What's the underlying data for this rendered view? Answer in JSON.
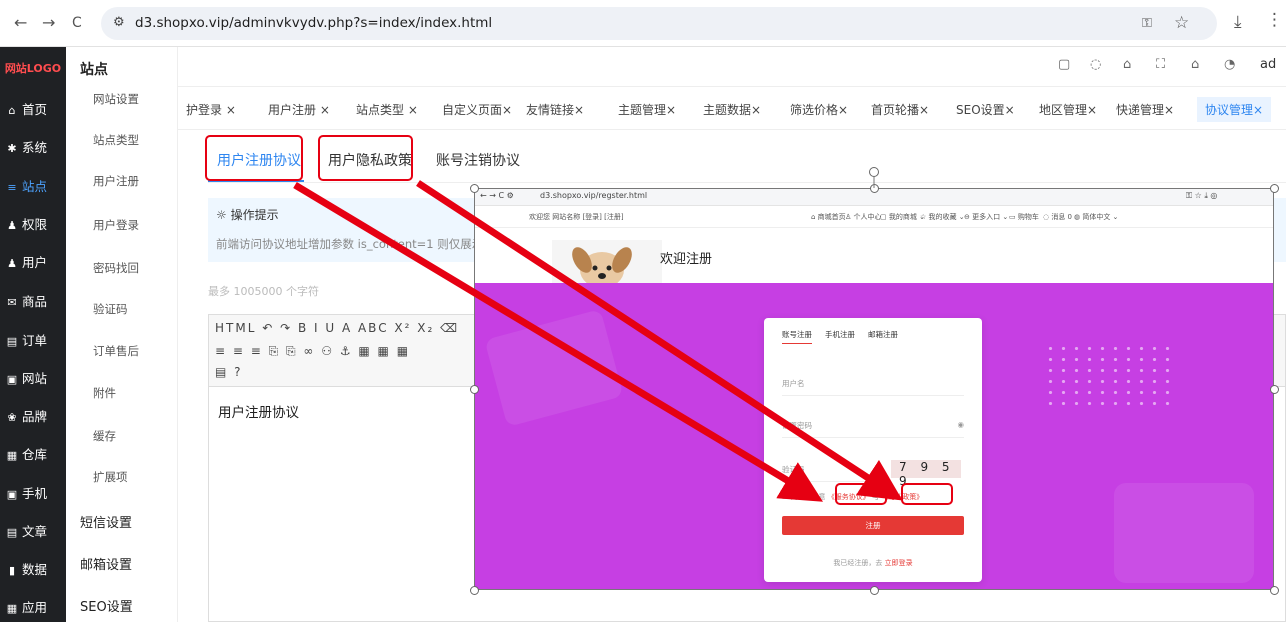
{
  "browser": {
    "url": "d3.shopxo.vip/adminvkvydv.php?s=index/index.html",
    "back_icon": "←",
    "forward_icon": "→",
    "reload_icon": "C",
    "tune_icon": "⚙",
    "password_icon": "⚿",
    "star_icon": "☆",
    "download_icon": "⤓",
    "more_icon": "⋮"
  },
  "logo": "网站LOGO",
  "main_nav": [
    {
      "icon": "⌂",
      "label": "首页"
    },
    {
      "icon": "✱",
      "label": "系统"
    },
    {
      "icon": "≡",
      "label": "站点"
    },
    {
      "icon": "♟",
      "label": "权限"
    },
    {
      "icon": "♟",
      "label": "用户"
    },
    {
      "icon": "✉",
      "label": "商品"
    },
    {
      "icon": "▤",
      "label": "订单"
    },
    {
      "icon": "▣",
      "label": "网站"
    },
    {
      "icon": "❀",
      "label": "品牌"
    },
    {
      "icon": "▦",
      "label": "仓库"
    },
    {
      "icon": "▣",
      "label": "手机"
    },
    {
      "icon": "▤",
      "label": "文章"
    },
    {
      "icon": "▮",
      "label": "数据"
    },
    {
      "icon": "▦",
      "label": "应用"
    }
  ],
  "sub_nav": {
    "title": "站点",
    "items": [
      "网站设置",
      "站点类型",
      "用户注册",
      "用户登录",
      "密码找回",
      "验证码",
      "订单售后",
      "附件",
      "缓存",
      "扩展项"
    ],
    "groups": [
      "短信设置",
      "邮箱设置",
      "SEO设置"
    ]
  },
  "topbar_icons": [
    "▢",
    "◌",
    "⌂",
    "⛶",
    "⌂",
    "◔"
  ],
  "topbar_user": "ad",
  "tabs": [
    "护登录 ×",
    "用户注册 ×",
    "站点类型 ×",
    "自定义页面×",
    "友情链接×",
    "主题管理×",
    "主题数据×",
    "筛选价格×",
    "首页轮播×",
    "SEO设置×",
    "地区管理×",
    "快递管理×",
    "协议管理×"
  ],
  "content": {
    "tabs": [
      "用户注册协议",
      "用户隐私政策",
      "账号注销协议"
    ],
    "tip_title": "操作提示",
    "tip_text": "前端访问协议地址增加参数 is_content=1 则仅展示纯",
    "max_chars": "最多 1005000 个字符",
    "toolbar_row1": "HTML  ↶ ↷  B I U A ABC X² X₂ ⌫",
    "toolbar_row2": "≡ ≡ ≡  ⎘ ⎘  ∞ ⚇ ⚓  ▦ ▦ ▦",
    "toolbar_row3": "▤ ?",
    "editor_text": "用户注册协议"
  },
  "embed": {
    "url": "d3.shopxo.vip/regster.html",
    "welcome_bar": "欢迎您 网站名称 [登录] [注册]",
    "top_nav": [
      "⌂ 商城首页",
      "♙ 个人中心",
      "▢ 我的商城 ⌄",
      "☆ 我的收藏 ⌄",
      "⊖ 更多入口 ⌄",
      "▭ 购物车",
      "◌ 消息 0",
      "◍ 简体中文 ⌄"
    ],
    "welcome": "欢迎注册",
    "card": {
      "tabs": [
        "账号注册",
        "手机注册",
        "邮箱注册"
      ],
      "username": "用户名",
      "password": "设置密码",
      "captcha_label": "验证码",
      "captcha": "7 9 5 9",
      "agree_text": "阅读并同意",
      "service": "《服务协议》",
      "and": "与",
      "privacy": "《隐私政策》",
      "submit": "注册",
      "login_text": "我已经注册，去",
      "login_link": "立即登录"
    }
  },
  "colors": {
    "accent": "#2e86f0",
    "annotation_red": "#e60012",
    "embed_purple": "#c63fe3",
    "sidebar_dark": "#1f2124"
  }
}
